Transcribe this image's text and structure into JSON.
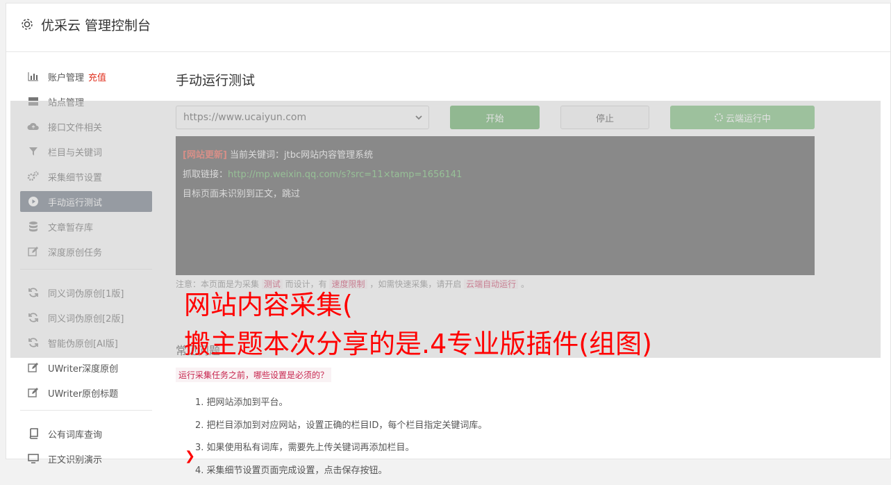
{
  "header": {
    "title": "优采云 管理控制台",
    "icon": "gear-icon"
  },
  "sidebar": {
    "items": [
      {
        "label": "账户管理",
        "tag": "充值",
        "icon": "bar-chart-icon"
      },
      {
        "label": "站点管理",
        "icon": "server-icon"
      },
      {
        "label": "接口文件相关",
        "icon": "cloud-upload-icon"
      },
      {
        "label": "栏目与关键词",
        "icon": "filter-icon"
      },
      {
        "label": "采集细节设置",
        "icon": "cogs-icon"
      },
      {
        "label": "手动运行测试",
        "icon": "play-circle-icon",
        "active": true
      },
      {
        "label": "文章暂存库",
        "icon": "database-icon"
      },
      {
        "label": "深度原创任务",
        "icon": "edit-icon"
      }
    ],
    "items2": [
      {
        "label": "同义词伪原创[1版]",
        "icon": "refresh-icon"
      },
      {
        "label": "同义词伪原创[2版]",
        "icon": "refresh-icon"
      },
      {
        "label": "智能伪原创[AI版]",
        "icon": "refresh-icon"
      },
      {
        "label": "UWriter深度原创",
        "icon": "edit-icon"
      },
      {
        "label": "UWriter原创标题",
        "icon": "edit-icon"
      }
    ],
    "items3": [
      {
        "label": "公有词库查询",
        "icon": "book-icon"
      },
      {
        "label": "正文识别演示",
        "icon": "monitor-icon"
      }
    ]
  },
  "main": {
    "title": "手动运行测试",
    "site_select": "https://www.ucaiyun.com",
    "start_label": "开始",
    "stop_label": "停止",
    "cloud_label": "云端运行中",
    "console": {
      "line1_tag": "[网站更新]",
      "line1_text": " 当前关键词：jtbc网站内容管理系统",
      "line2_label": "抓取链接：",
      "line2_link": "http://mp.weixin.qq.com/s?src=11×tamp=1656141",
      "line3": "目标页面未识别到正文，跳过"
    },
    "note": {
      "p1": "注意：本页面是为采集 ",
      "c1": "测试",
      "p2": " 而设计，有 ",
      "c2": "速度限制",
      "p3": " ，如需快速采集，请开启 ",
      "c3": "云端自动运行",
      "p4": " 。"
    },
    "faq_title": "常见问题",
    "faq_question": "运行采集任务之前，哪些设置是必须的？",
    "faq_items": [
      "1. 把网站添加到平台。",
      "2. 把栏目添加到对应网站，设置正确的栏目ID，每个栏目指定关键词库。",
      "3. 如果使用私有词库，需要先上传关键词再添加栏目。",
      "4. 采集细节设置页面完成设置，点击保存按钮。"
    ]
  },
  "overlay": {
    "line1": "网站内容采集(",
    "line2": "搬主题本次分享的是.4专业版插件(组图)",
    "color": "#ff0000"
  }
}
